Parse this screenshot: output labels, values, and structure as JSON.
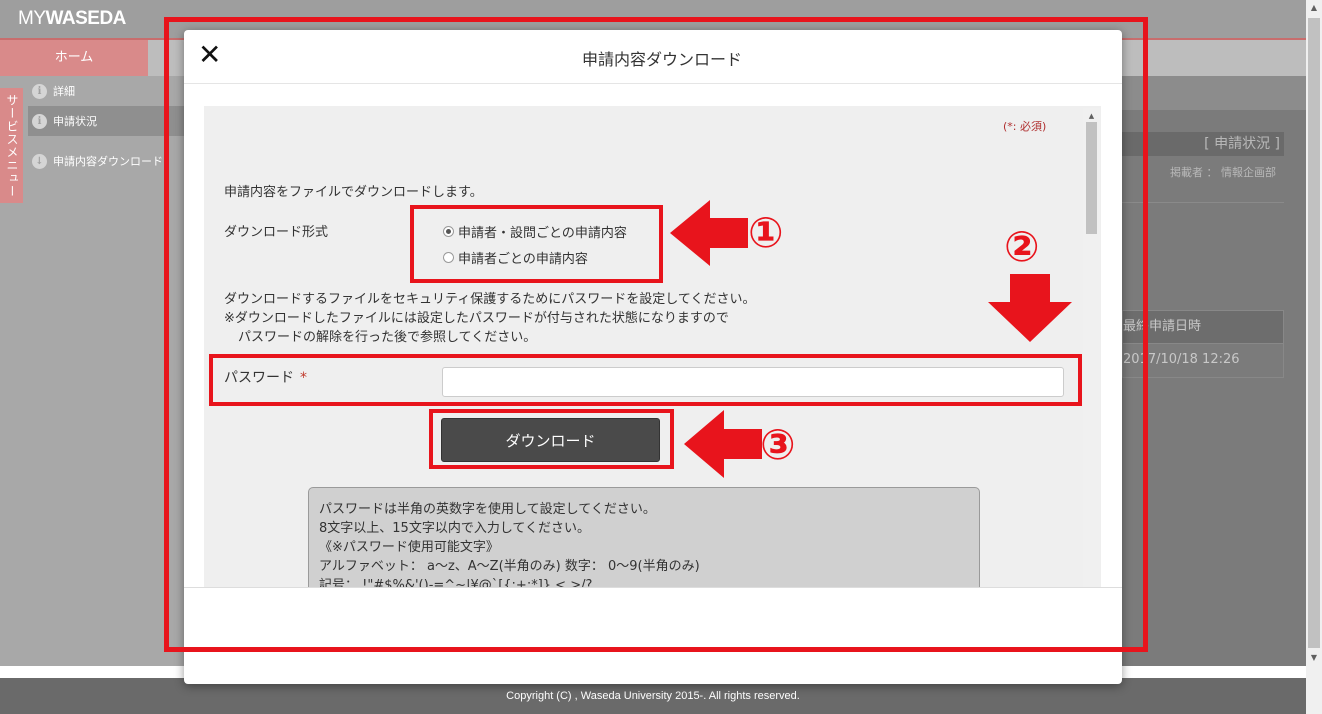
{
  "app": {
    "logo_light": "MY",
    "logo_bold": "WASEDA"
  },
  "nav": {
    "home": "ホーム"
  },
  "sidebar": {
    "service_menu": "サービスメニュー",
    "items": [
      {
        "label": "詳細",
        "icon": "info-icon"
      },
      {
        "label": "申請状況",
        "icon": "info-icon"
      },
      {
        "label": "申請内容ダウンロード",
        "icon": "download-icon"
      }
    ]
  },
  "background": {
    "status_heading": "[ 申請状況 ]",
    "poster": "掲載者 ： 情報企画部",
    "table_header": "最終申請日時",
    "table_cell": "2017/10/18 12:26"
  },
  "footer": {
    "copyright": "Copyright (C) , Waseda University 2015-. All rights reserved."
  },
  "modal": {
    "title": "申請内容ダウンロード",
    "close_icon": "close-icon",
    "required_note": "(*: 必須)",
    "intro": "申請内容をファイルでダウンロードします。",
    "format_label": "ダウンロード形式",
    "format_options": [
      {
        "label": "申請者・設問ごとの申請内容",
        "selected": true
      },
      {
        "label": "申請者ごとの申請内容",
        "selected": false
      }
    ],
    "password_notes": [
      "ダウンロードするファイルをセキュリティ保護するためにパスワードを設定してください。",
      "※ダウンロードしたファイルには設定したパスワードが付与された状態になりますので",
      "パスワードの解除を行った後で参照してください。"
    ],
    "password_label": "パスワード",
    "password_required_mark": "*",
    "password_value": "",
    "download_button": "ダウンロード",
    "hint_lines": [
      "パスワードは半角の英数字を使用して設定してください。",
      "8文字以上、15文字以内で入力してください。",
      "《※パスワード使用可能文字》",
      "アルファベット： a～z、A～Z(半角のみ)  数字： 0～9(半角のみ)",
      "記号： !\"#$%&'()-=^~|¥@`[{;+:*]},<.>/?_"
    ]
  },
  "annotations": {
    "markers": [
      "①",
      "②",
      "③"
    ],
    "color": "#e8141c"
  }
}
